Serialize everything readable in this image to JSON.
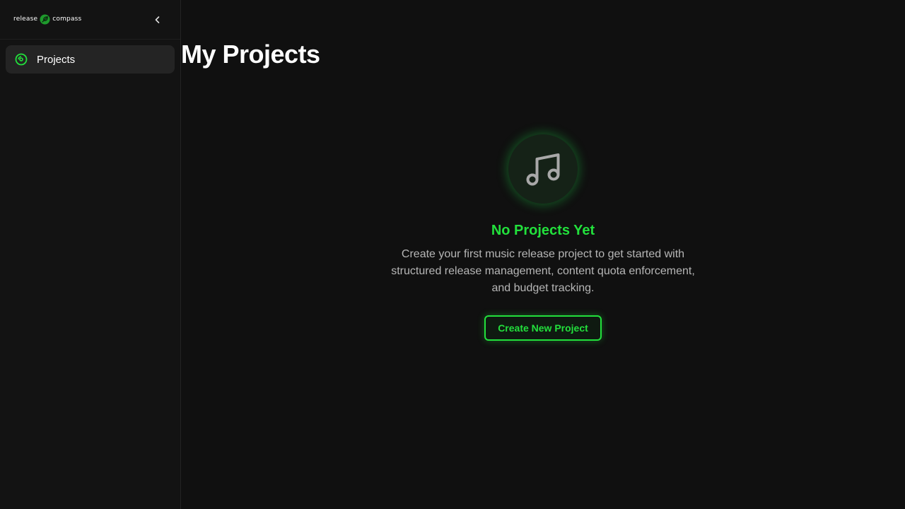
{
  "sidebar": {
    "logo": {
      "left_text": "release",
      "right_text": "compass",
      "mark_icon": "leaf-compass-icon"
    },
    "collapse_icon": "chevron-left-icon",
    "items": [
      {
        "label": "Projects",
        "icon": "disc-icon",
        "active": true
      }
    ]
  },
  "main": {
    "title": "My Projects",
    "empty_state": {
      "icon": "music-note-icon",
      "title": "No Projects Yet",
      "description": "Create your first music release project to get started with structured release management, content quota enforcement, and budget tracking.",
      "button_label": "Create New Project"
    }
  },
  "colors": {
    "accent": "#22e03c",
    "background": "#101010",
    "sidebar": "#131313",
    "active_item": "#242424"
  }
}
